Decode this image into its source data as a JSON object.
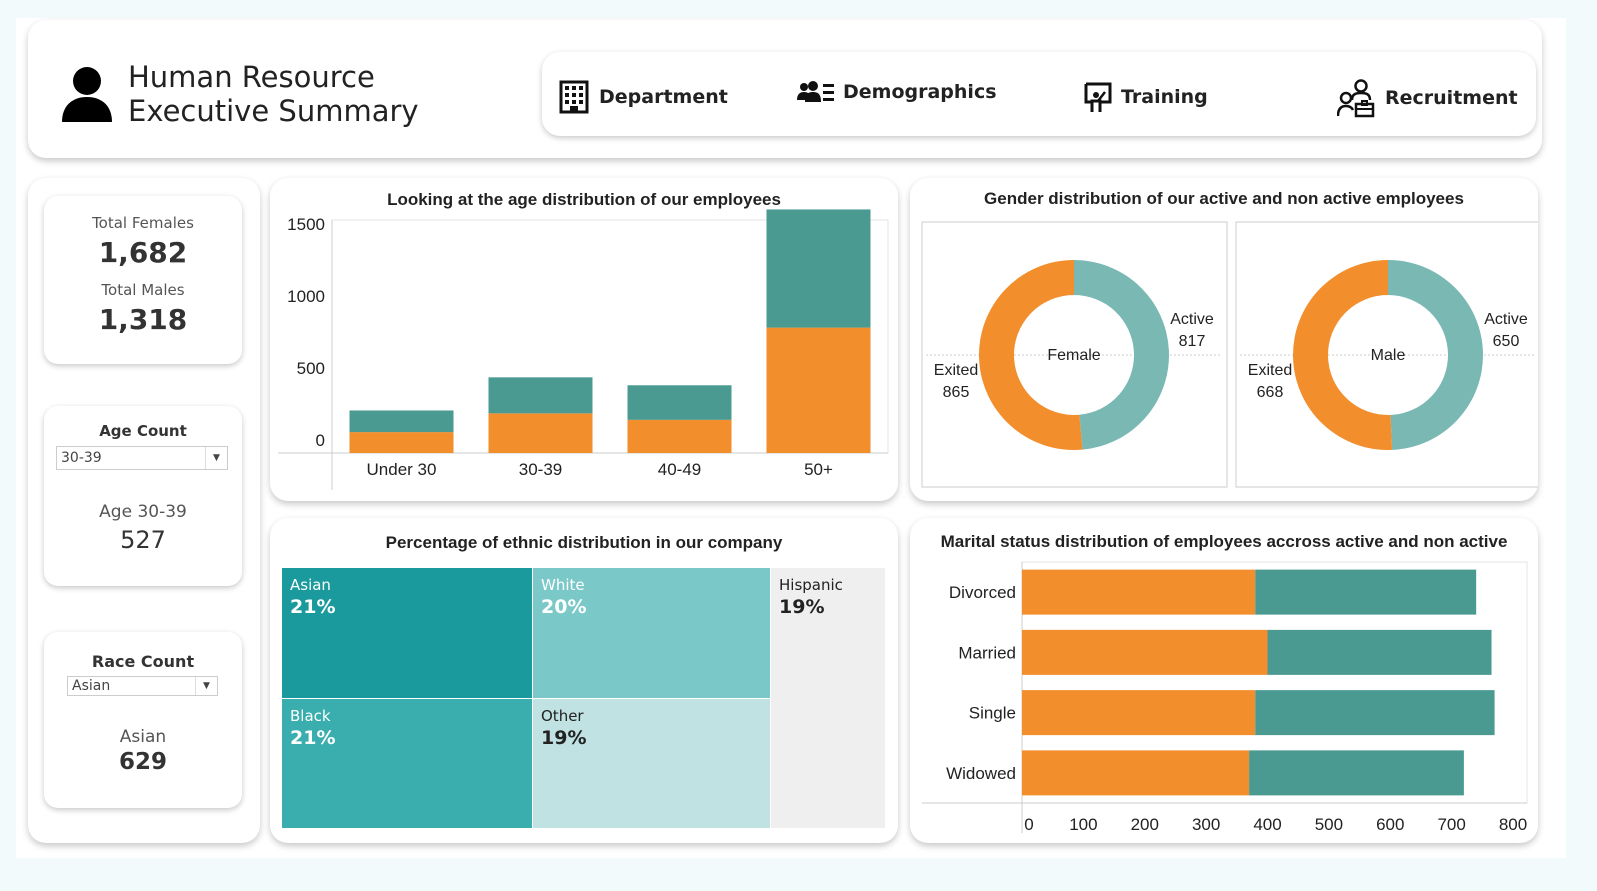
{
  "header": {
    "title_line1": "Human Resource",
    "title_line2": "Executive Summary",
    "nav": [
      {
        "label": "Department",
        "icon": "building-icon"
      },
      {
        "label": "Demographics",
        "icon": "users-list-icon"
      },
      {
        "label": "Training",
        "icon": "presentation-icon"
      },
      {
        "label": "Recruitment",
        "icon": "recruitment-icon"
      }
    ]
  },
  "kpis": {
    "females_label": "Total Females",
    "females_value": "1,682",
    "males_label": "Total Males",
    "males_value": "1,318",
    "age_heading": "Age Count",
    "age_selected": "30-39",
    "age_result_label": "Age 30-39",
    "age_result_value": "527",
    "race_heading": "Race Count",
    "race_selected": "Asian",
    "race_result_label": "Asian",
    "race_result_value": "629"
  },
  "colors": {
    "orange": "#f28e2b",
    "teal": "#4a9a91",
    "light_teal": "#79b8b3"
  },
  "age_chart": {
    "title": "Looking at the age distribution of our employees",
    "chart_data": {
      "type": "bar",
      "stacked": true,
      "categories": [
        "Under 30",
        "30-39",
        "40-49",
        "50+"
      ],
      "series": [
        {
          "values": [
            145,
            275,
            230,
            870
          ]
        },
        {
          "values": [
            150,
            250,
            240,
            820
          ]
        }
      ],
      "yticks": [
        "0",
        "500",
        "1000",
        "1500"
      ],
      "ylim": [
        0,
        1700
      ]
    }
  },
  "gender_chart": {
    "title": "Gender distribution of our active and non active employees",
    "chart_data": [
      {
        "type": "pie",
        "center_label": "Female",
        "slices": [
          {
            "label": "Active",
            "value": 817
          },
          {
            "label": "Exited",
            "value": 865
          }
        ]
      },
      {
        "type": "pie",
        "center_label": "Male",
        "slices": [
          {
            "label": "Active",
            "value": 650
          },
          {
            "label": "Exited",
            "value": 668
          }
        ]
      }
    ]
  },
  "ethnic_chart": {
    "title": "Percentage of ethnic distribution in our company",
    "cells": [
      {
        "name": "Asian",
        "pct": "21%"
      },
      {
        "name": "White",
        "pct": "20%"
      },
      {
        "name": "Hispanic",
        "pct": "19%"
      },
      {
        "name": "Black",
        "pct": "21%"
      },
      {
        "name": "Other",
        "pct": "19%"
      }
    ]
  },
  "marital_chart": {
    "title": "Marital status distribution of employees accross active and non active",
    "chart_data": {
      "type": "bar",
      "orientation": "horizontal",
      "stacked": true,
      "categories": [
        "Divorced",
        "Married",
        "Single",
        "Widowed"
      ],
      "series": [
        {
          "values": [
            380,
            400,
            380,
            370
          ]
        },
        {
          "values": [
            360,
            365,
            390,
            350
          ]
        }
      ],
      "xticks": [
        "0",
        "100",
        "200",
        "300",
        "400",
        "500",
        "600",
        "700",
        "800"
      ],
      "xlim": [
        0,
        800
      ]
    }
  }
}
